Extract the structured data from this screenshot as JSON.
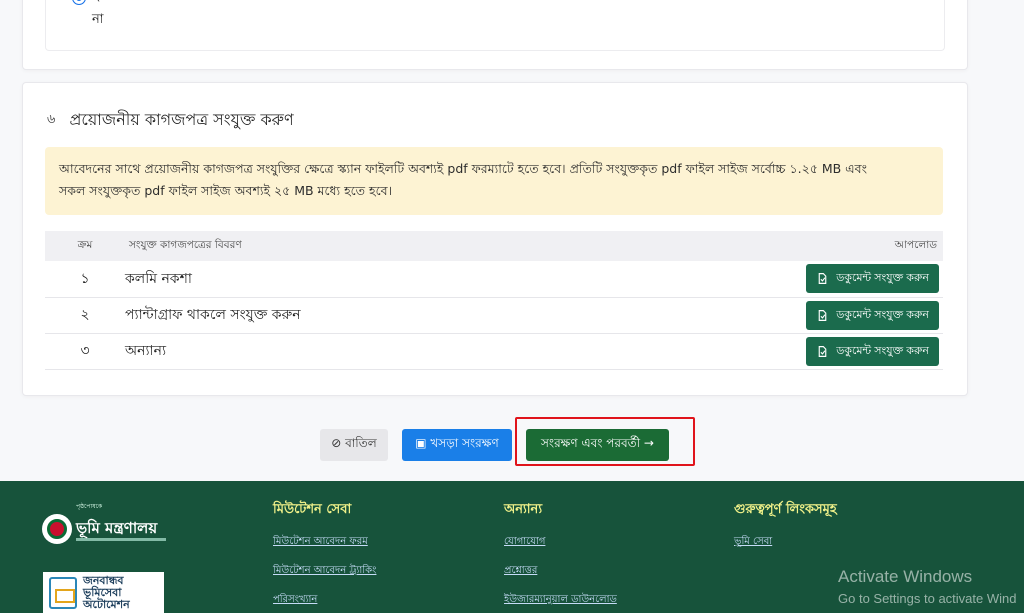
{
  "top_question": {
    "options": [
      {
        "label": "হ্যাঁ",
        "checked": true
      },
      {
        "label": "না",
        "checked": false
      }
    ]
  },
  "documents_section": {
    "number": "৬",
    "title": "প্রয়োজনীয় কাগজপত্র সংযুক্ত করুণ",
    "notice_line1": "আবেদনের সাথে প্রয়োজনীয় কাগজপত্র সংযুক্তির ক্ষেত্রে স্ক্যান ফাইলটি অবশ্যই pdf ফরম্যাটে হতে হবে। প্রতিটি সংযুক্তকৃত pdf ফাইল সাইজ সর্বোচ্চ ১.২৫ MB এবং",
    "notice_line2": "সকল সংযুক্তকৃত pdf ফাইল সাইজ অবশ্যই ২৫ MB মধ্যে হতে হবে।",
    "table": {
      "headers": {
        "serial": "ক্রম",
        "description": "সংযুক্ত কাগজপত্রের বিবরণ",
        "upload": "আপলোড"
      },
      "rows": [
        {
          "serial": "১",
          "description": "কলমি নকশা",
          "button": "ডকুমেন্ট সংযুক্ত করুন"
        },
        {
          "serial": "২",
          "description": "প্যান্টাগ্রাফ থাকলে সংযুক্ত করুন",
          "button": "ডকুমেন্ট সংযুক্ত করুন"
        },
        {
          "serial": "৩",
          "description": "অন্যান্য",
          "button": "ডকুমেন্ট সংযুক্ত করুন"
        }
      ]
    }
  },
  "actions": {
    "cancel": "⊘ বাতিল",
    "draft": "▣ খসড়া সংরক্ষণ",
    "save_next": "সংরক্ষণ এবং পরবর্তী →"
  },
  "footer": {
    "ministry_caption": "পৃষ্ঠপোষকে",
    "ministry_name": "ভূমি মন্ত্রণালয়",
    "logo2_text_line1": "জনবান্ধব",
    "logo2_text_line2": "ভূমিসেবা",
    "logo2_text_line3": "অটোমেশন",
    "columns": [
      {
        "title": "মিউটেশন সেবা",
        "links": [
          "মিউটেশন আবেদন ফরম",
          "মিউটেশন আবেদন ট্র্যাকিং",
          "পরিসংখ্যান"
        ]
      },
      {
        "title": "অন্যান্য",
        "links": [
          "যোগাযোগ",
          "প্রশ্নোত্তর",
          "ইউজারম্যানুয়াল ডাউনলোড"
        ]
      },
      {
        "title": "গুরুত্বপূর্ণ লিংকসমূহ",
        "links": [
          "ভূমি সেবা"
        ]
      }
    ]
  },
  "os_watermark": {
    "line1": "Activate Windows",
    "line2": "Go to Settings to activate Wind"
  },
  "colors": {
    "primary_green": "#1b6b4d",
    "footer_green": "#17533b",
    "draft_blue": "#1a7fe8",
    "notice_bg": "#fdf3d3",
    "highlight_red": "#e0141b"
  }
}
